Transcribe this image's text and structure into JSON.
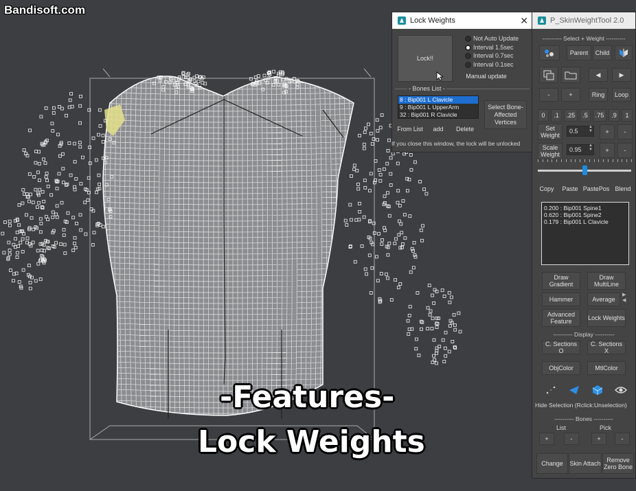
{
  "watermark": "Bandisoft.com",
  "captions": {
    "line1": "-Features-",
    "line2": "Lock Weights"
  },
  "lock_window": {
    "title": "Lock Weights",
    "lock_button": "Lock!!",
    "update_options": [
      "Not Auto Update",
      "Interval 1.5sec",
      "Interval 0.7sec",
      "Interval 0.1sec"
    ],
    "selected_option": 1,
    "manual_update": "Manual update",
    "bones_list_label": "- Bones List -",
    "bones": [
      "8 : Bip001 L Clavicle",
      "9 : Bip001 L UpperArm",
      "32 : Bip001 R Clavicle"
    ],
    "selected_bone": 0,
    "select_bone_button": "Select Bone-Affected Vertices",
    "from_list": "From List",
    "add": "add",
    "delete": "Delete",
    "note": "If you close this window, the lock will be unlocked"
  },
  "skin_tool": {
    "title": "P_SkinWeightTool 2.0",
    "select_weight_sep": "---------- Select + Weight ----------",
    "parent": "Parent",
    "child": "Child",
    "minus": "-",
    "plus": "+",
    "ring": "Ring",
    "loop": "Loop",
    "prev": "◀",
    "next": "▶",
    "presets": [
      "0",
      ".1",
      ".25",
      ".5",
      ".75",
      ".9",
      "1"
    ],
    "set_weight_label": "Set Weight",
    "set_weight_value": "0.5",
    "scale_weight_label": "Scale Weight",
    "scale_weight_value": "0.95",
    "slider_value": 0.5,
    "copy": "Copy",
    "paste": "Paste",
    "pastepos": "PastePos",
    "blend": "Blend",
    "weights": [
      "0.200 : Bip001 Spine1",
      "0.620 : Bip001 Spine2",
      "0.179 : Bip001 L Clavicle"
    ],
    "draw_gradient": "Draw Gradient",
    "draw_multiline": "Draw MultiLine",
    "hammer": "Hammer",
    "average": "Average",
    "advanced_feature": "Advanced Feature",
    "lock_weights": "Lock Weights",
    "display_sep": "---------- Display ----------",
    "c_sections_o": "C. Sections O",
    "c_sections_x": "C. Sections X",
    "objcolor": "ObjColor",
    "mtlcolor": "MtlColor",
    "hide_selection": "Hide Selection (Rclick:Unselection)",
    "bones_sep": "---------- Bones ----------",
    "list": "List",
    "pick": "Pick",
    "change": "Change",
    "skin_attach": "Skin Attach",
    "remove_zero_bone": "Remove Zero Bone"
  },
  "colors": {
    "viewport": "#3d3e42",
    "panel": "#444444",
    "button": "#4a4a4a",
    "accent": "#1e8de0",
    "selection": "#1e6ecf",
    "highlight_vertex": "#e3e08a"
  }
}
